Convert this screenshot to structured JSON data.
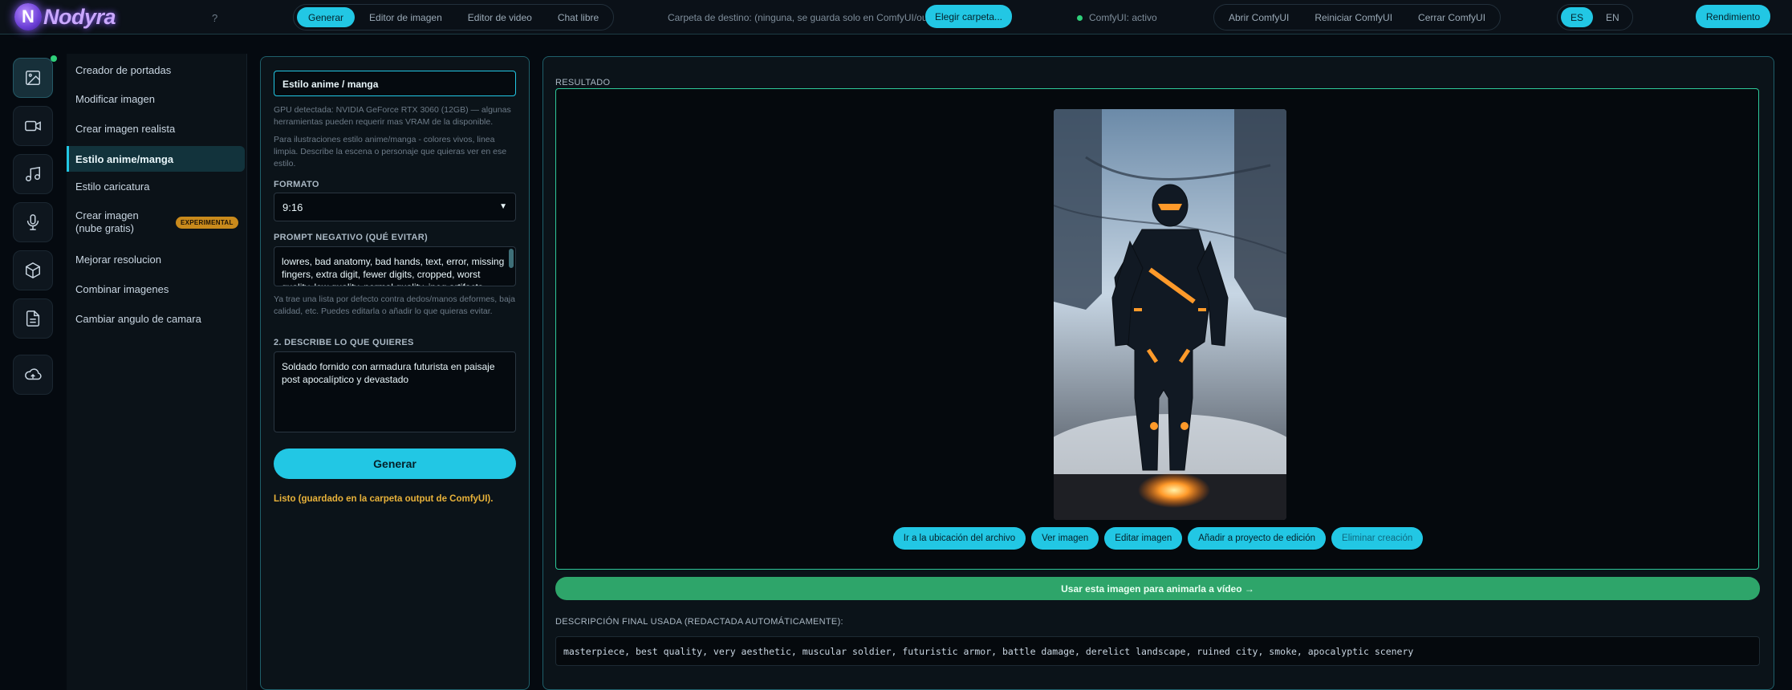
{
  "app": {
    "logo_letter": "N",
    "logo_text": "Nodyra",
    "help": "?"
  },
  "topnav": {
    "tabs": [
      {
        "label": "Generar",
        "active": true
      },
      {
        "label": "Editor de imagen",
        "active": false
      },
      {
        "label": "Editor de video",
        "active": false
      },
      {
        "label": "Chat libre",
        "active": false
      }
    ]
  },
  "destination": {
    "label": "Carpeta de destino: (ninguna, se guarda solo en ComfyUI/output)",
    "choose_button": "Elegir carpeta..."
  },
  "status": {
    "text": "ComfyUI: activo",
    "dot_color": "#2fd07a"
  },
  "comfy_actions": [
    "Abrir ComfyUI",
    "Reiniciar ComfyUI",
    "Cerrar ComfyUI"
  ],
  "language": {
    "options": [
      "ES",
      "EN"
    ],
    "selected": "ES"
  },
  "performance_button": "Rendimiento",
  "rail": {
    "icons": [
      "image-icon",
      "video-icon",
      "music-icon",
      "microphone-icon",
      "cube-icon",
      "document-icon",
      "cloud-upload-icon"
    ],
    "active": "image-icon"
  },
  "nav": {
    "items": [
      {
        "label": "Creador de portadas"
      },
      {
        "label": "Modificar imagen"
      },
      {
        "label": "Crear imagen realista"
      },
      {
        "label": "Estilo anime/manga",
        "active": true
      },
      {
        "label": "Estilo caricatura"
      },
      {
        "label": "Crear imagen (nube gratis)",
        "badge": "EXPERIMENTAL"
      },
      {
        "label": "Mejorar resolucion"
      },
      {
        "label": "Combinar imagenes"
      },
      {
        "label": "Cambiar angulo de camara"
      }
    ]
  },
  "form": {
    "title_value": "Estilo anime / manga",
    "gpu_hint": "GPU detectada: NVIDIA GeForce RTX 3060 (12GB) — algunas herramientas pueden requerir mas VRAM de la disponible.",
    "style_hint": "Para ilustraciones estilo anime/manga - colores vivos, linea limpia. Describe la escena o personaje que quieras ver en ese estilo.",
    "format_label": "FORMATO",
    "format_value": "9:16",
    "negative_label": "PROMPT NEGATIVO (QUÉ EVITAR)",
    "negative_value": "lowres, bad anatomy, bad hands, text, error, missing fingers, extra digit, fewer digits, cropped, worst quality, low quality, normal quality, jpeg artifacts, signature, watermark, username, blurry",
    "negative_hint": "Ya trae una lista por defecto contra dedos/manos deformes, baja calidad, etc. Puedes editarla o añadir lo que quieras evitar.",
    "describe_label": "2. DESCRIBE LO QUE QUIERES",
    "describe_value": "Soldado fornido con armadura futurista en paisaje post apocalíptico y devastado",
    "generate_button": "Generar",
    "status_text": "Listo (guardado en la carpeta output de ComfyUI)."
  },
  "result": {
    "label": "RESULTADO",
    "actions": [
      "Ir a la ubicación del archivo",
      "Ver imagen",
      "Editar imagen",
      "Añadir a proyecto de edición",
      "Eliminar creación"
    ],
    "animate_button": "Usar esta imagen para animarla a vídeo →",
    "final_desc_label": "DESCRIPCIÓN FINAL USADA (REDACTADA AUTOMÁTICAMENTE):",
    "final_desc_value": "masterpiece, best quality, very aesthetic, muscular soldier, futuristic armor, battle damage, derelict landscape, ruined city, smoke, apocalyptic scenery"
  }
}
